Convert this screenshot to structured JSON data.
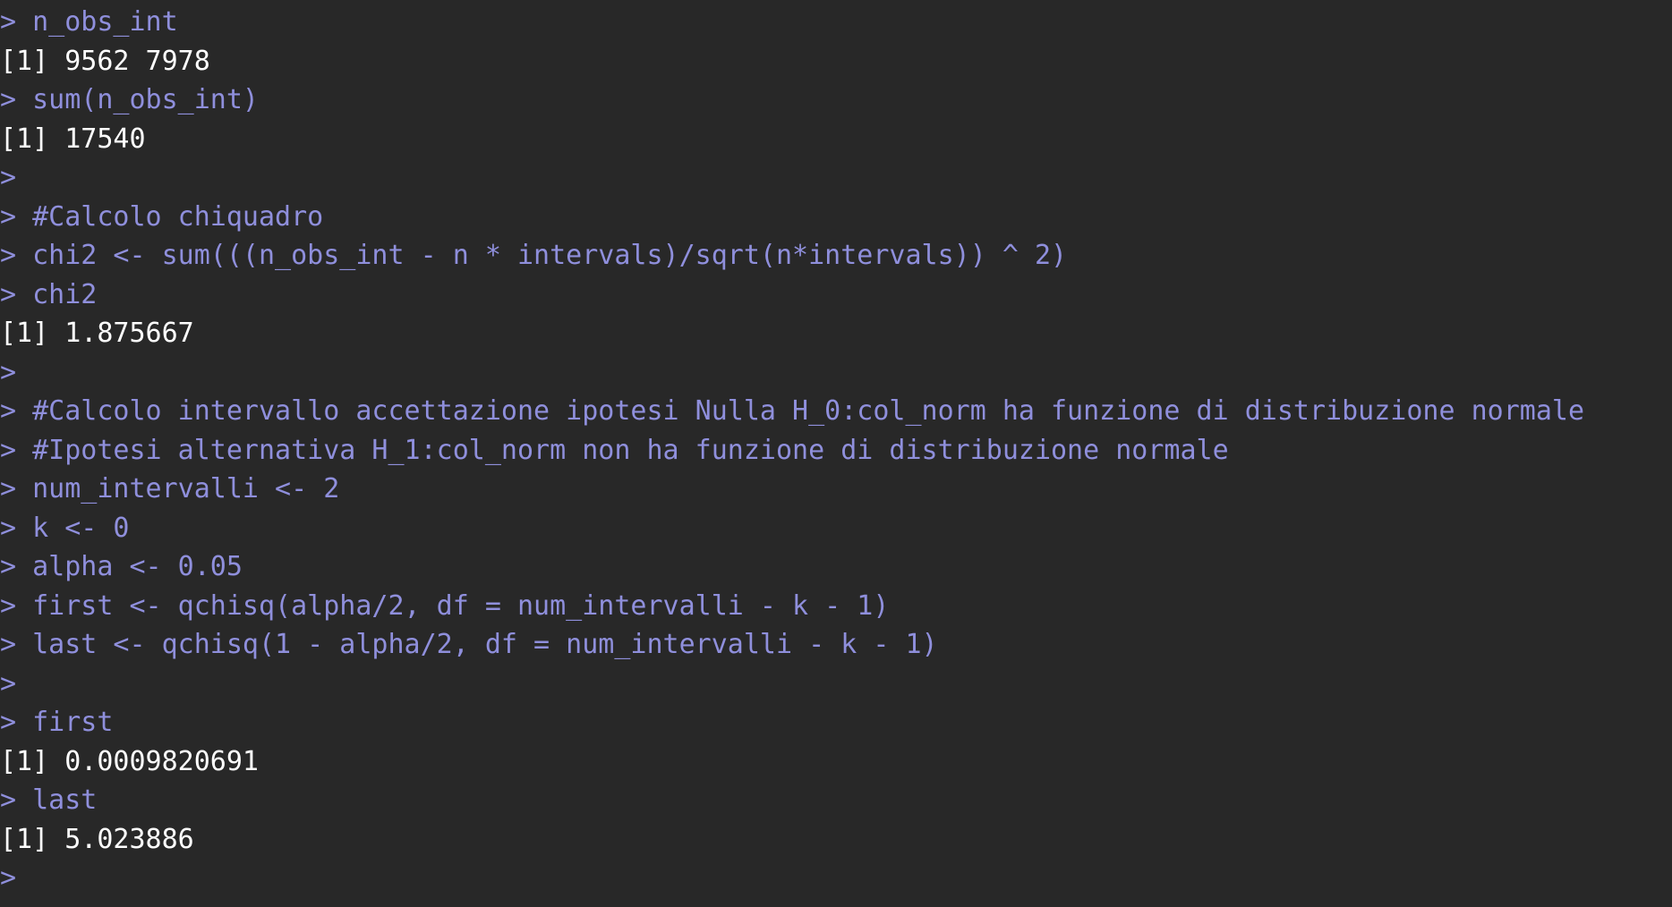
{
  "console": {
    "prompt": ">",
    "lines": [
      {
        "type": "input",
        "text": "> n_obs_int"
      },
      {
        "type": "output",
        "text": "[1] 9562 7978"
      },
      {
        "type": "input",
        "text": "> sum(n_obs_int)"
      },
      {
        "type": "output",
        "text": "[1] 17540"
      },
      {
        "type": "input",
        "text": ">"
      },
      {
        "type": "input",
        "text": "> #Calcolo chiquadro"
      },
      {
        "type": "input",
        "text": "> chi2 <- sum(((n_obs_int - n * intervals)/sqrt(n*intervals)) ^ 2)"
      },
      {
        "type": "input",
        "text": "> chi2"
      },
      {
        "type": "output",
        "text": "[1] 1.875667"
      },
      {
        "type": "input",
        "text": ">"
      },
      {
        "type": "input",
        "text": "> #Calcolo intervallo accettazione ipotesi Nulla H_0:col_norm ha funzione di distribuzione normale"
      },
      {
        "type": "input",
        "text": "> #Ipotesi alternativa H_1:col_norm non ha funzione di distribuzione normale"
      },
      {
        "type": "input",
        "text": "> num_intervalli <- 2"
      },
      {
        "type": "input",
        "text": "> k <- 0"
      },
      {
        "type": "input",
        "text": "> alpha <- 0.05"
      },
      {
        "type": "input",
        "text": "> first <- qchisq(alpha/2, df = num_intervalli - k - 1)"
      },
      {
        "type": "input",
        "text": "> last <- qchisq(1 - alpha/2, df = num_intervalli - k - 1)"
      },
      {
        "type": "input",
        "text": ">"
      },
      {
        "type": "input",
        "text": "> first"
      },
      {
        "type": "output",
        "text": "[1] 0.0009820691"
      },
      {
        "type": "input",
        "text": "> last"
      },
      {
        "type": "output",
        "text": "[1] 5.023886"
      },
      {
        "type": "input",
        "text": ">"
      }
    ]
  },
  "colors": {
    "background": "#282828",
    "input_text": "#8f8fdc",
    "output_text": "#ffffff"
  }
}
